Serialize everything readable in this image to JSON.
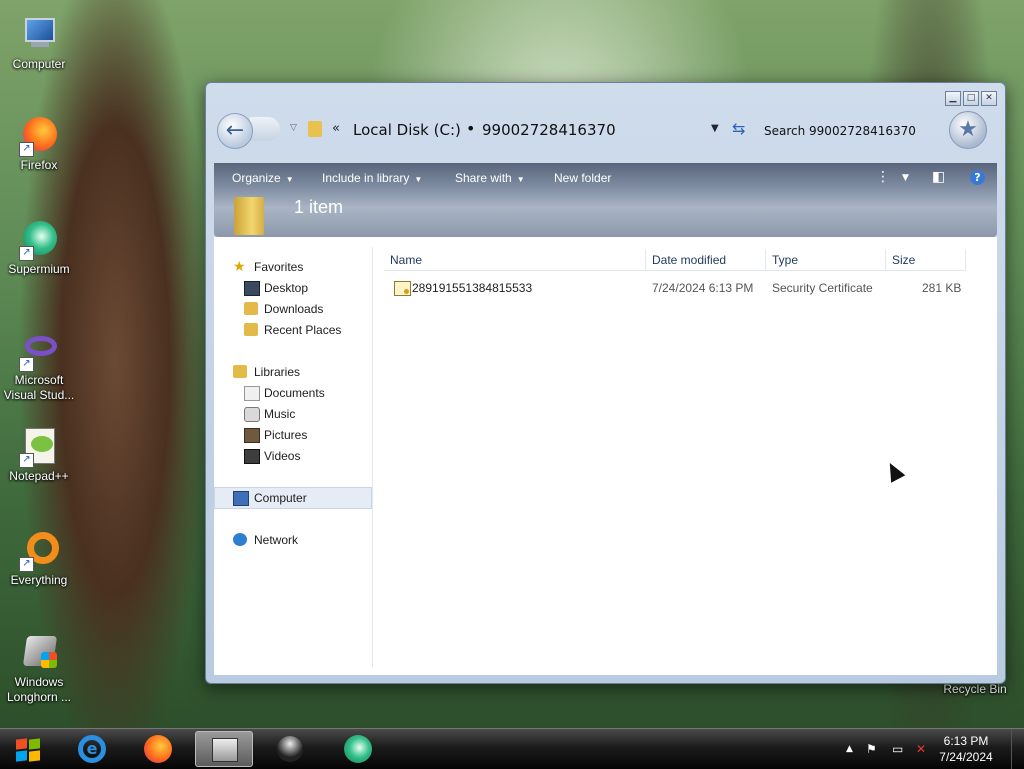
{
  "desktop": {
    "icons": [
      {
        "label": "Computer",
        "icon": "computer-icon"
      },
      {
        "label": "Firefox",
        "icon": "firefox-icon"
      },
      {
        "label": "Supermium",
        "icon": "supermium-icon"
      },
      {
        "label": "Microsoft Visual Stud...",
        "icon": "visual-studio-icon"
      },
      {
        "label": "Notepad++",
        "icon": "notepadpp-icon"
      },
      {
        "label": "Everything",
        "icon": "everything-icon"
      },
      {
        "label": "Windows Longhorn ...",
        "icon": "windows-longhorn-icon"
      },
      {
        "label": "Recycle Bin",
        "icon": "recycle-bin-icon"
      }
    ]
  },
  "window": {
    "breadcrumb": [
      "Local Disk (C:)",
      "99002728416370"
    ],
    "breadcrumb_overflow": "«",
    "breadcrumb_separator": "•",
    "search_placeholder": "Search 99002728416370",
    "toolbar": {
      "organize": "Organize",
      "include_in_library": "Include in library",
      "share_with": "Share with",
      "new_folder": "New folder"
    },
    "item_count": "1 item",
    "nav": {
      "favorites": "Favorites",
      "desktop": "Desktop",
      "downloads": "Downloads",
      "recent_places": "Recent Places",
      "libraries": "Libraries",
      "documents": "Documents",
      "music": "Music",
      "pictures": "Pictures",
      "videos": "Videos",
      "computer": "Computer",
      "network": "Network"
    },
    "columns": {
      "name": "Name",
      "date_modified": "Date modified",
      "type": "Type",
      "size": "Size"
    },
    "files": [
      {
        "name": "289191551384815533",
        "date_modified": "7/24/2024 6:13 PM",
        "type": "Security Certificate",
        "size": "281 KB"
      }
    ]
  },
  "taskbar": {
    "apps": [
      "internet-explorer-icon",
      "firefox-icon",
      "file-explorer-icon",
      "obs-icon",
      "supermium-icon"
    ],
    "time": "6:13 PM",
    "date": "7/24/2024"
  },
  "colors": {
    "accent": "#3a78d6",
    "taskbar": "#1c1c1c",
    "folder": "#e3b94a"
  }
}
